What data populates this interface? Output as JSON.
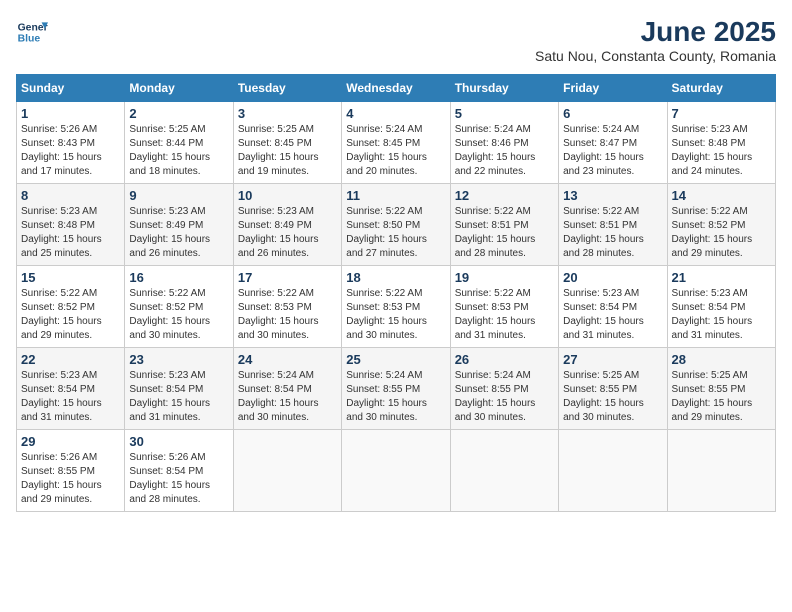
{
  "header": {
    "logo_line1": "General",
    "logo_line2": "Blue",
    "month_title": "June 2025",
    "subtitle": "Satu Nou, Constanta County, Romania"
  },
  "calendar": {
    "days_of_week": [
      "Sunday",
      "Monday",
      "Tuesday",
      "Wednesday",
      "Thursday",
      "Friday",
      "Saturday"
    ],
    "weeks": [
      [
        {
          "day": "",
          "info": ""
        },
        {
          "day": "2",
          "info": "Sunrise: 5:25 AM\nSunset: 8:44 PM\nDaylight: 15 hours\nand 18 minutes."
        },
        {
          "day": "3",
          "info": "Sunrise: 5:25 AM\nSunset: 8:45 PM\nDaylight: 15 hours\nand 19 minutes."
        },
        {
          "day": "4",
          "info": "Sunrise: 5:24 AM\nSunset: 8:45 PM\nDaylight: 15 hours\nand 20 minutes."
        },
        {
          "day": "5",
          "info": "Sunrise: 5:24 AM\nSunset: 8:46 PM\nDaylight: 15 hours\nand 22 minutes."
        },
        {
          "day": "6",
          "info": "Sunrise: 5:24 AM\nSunset: 8:47 PM\nDaylight: 15 hours\nand 23 minutes."
        },
        {
          "day": "7",
          "info": "Sunrise: 5:23 AM\nSunset: 8:48 PM\nDaylight: 15 hours\nand 24 minutes."
        }
      ],
      [
        {
          "day": "1",
          "info": "Sunrise: 5:26 AM\nSunset: 8:43 PM\nDaylight: 15 hours\nand 17 minutes.",
          "first": true
        },
        {
          "day": "9",
          "info": "Sunrise: 5:23 AM\nSunset: 8:49 PM\nDaylight: 15 hours\nand 26 minutes."
        },
        {
          "day": "10",
          "info": "Sunrise: 5:23 AM\nSunset: 8:49 PM\nDaylight: 15 hours\nand 26 minutes."
        },
        {
          "day": "11",
          "info": "Sunrise: 5:22 AM\nSunset: 8:50 PM\nDaylight: 15 hours\nand 27 minutes."
        },
        {
          "day": "12",
          "info": "Sunrise: 5:22 AM\nSunset: 8:51 PM\nDaylight: 15 hours\nand 28 minutes."
        },
        {
          "day": "13",
          "info": "Sunrise: 5:22 AM\nSunset: 8:51 PM\nDaylight: 15 hours\nand 28 minutes."
        },
        {
          "day": "14",
          "info": "Sunrise: 5:22 AM\nSunset: 8:52 PM\nDaylight: 15 hours\nand 29 minutes."
        }
      ],
      [
        {
          "day": "8",
          "info": "Sunrise: 5:23 AM\nSunset: 8:48 PM\nDaylight: 15 hours\nand 25 minutes."
        },
        {
          "day": "16",
          "info": "Sunrise: 5:22 AM\nSunset: 8:52 PM\nDaylight: 15 hours\nand 30 minutes."
        },
        {
          "day": "17",
          "info": "Sunrise: 5:22 AM\nSunset: 8:53 PM\nDaylight: 15 hours\nand 30 minutes."
        },
        {
          "day": "18",
          "info": "Sunrise: 5:22 AM\nSunset: 8:53 PM\nDaylight: 15 hours\nand 30 minutes."
        },
        {
          "day": "19",
          "info": "Sunrise: 5:22 AM\nSunset: 8:53 PM\nDaylight: 15 hours\nand 31 minutes."
        },
        {
          "day": "20",
          "info": "Sunrise: 5:23 AM\nSunset: 8:54 PM\nDaylight: 15 hours\nand 31 minutes."
        },
        {
          "day": "21",
          "info": "Sunrise: 5:23 AM\nSunset: 8:54 PM\nDaylight: 15 hours\nand 31 minutes."
        }
      ],
      [
        {
          "day": "15",
          "info": "Sunrise: 5:22 AM\nSunset: 8:52 PM\nDaylight: 15 hours\nand 29 minutes."
        },
        {
          "day": "23",
          "info": "Sunrise: 5:23 AM\nSunset: 8:54 PM\nDaylight: 15 hours\nand 31 minutes."
        },
        {
          "day": "24",
          "info": "Sunrise: 5:24 AM\nSunset: 8:54 PM\nDaylight: 15 hours\nand 30 minutes."
        },
        {
          "day": "25",
          "info": "Sunrise: 5:24 AM\nSunset: 8:55 PM\nDaylight: 15 hours\nand 30 minutes."
        },
        {
          "day": "26",
          "info": "Sunrise: 5:24 AM\nSunset: 8:55 PM\nDaylight: 15 hours\nand 30 minutes."
        },
        {
          "day": "27",
          "info": "Sunrise: 5:25 AM\nSunset: 8:55 PM\nDaylight: 15 hours\nand 30 minutes."
        },
        {
          "day": "28",
          "info": "Sunrise: 5:25 AM\nSunset: 8:55 PM\nDaylight: 15 hours\nand 29 minutes."
        }
      ],
      [
        {
          "day": "22",
          "info": "Sunrise: 5:23 AM\nSunset: 8:54 PM\nDaylight: 15 hours\nand 31 minutes."
        },
        {
          "day": "30",
          "info": "Sunrise: 5:26 AM\nSunset: 8:54 PM\nDaylight: 15 hours\nand 28 minutes."
        },
        {
          "day": "",
          "info": ""
        },
        {
          "day": "",
          "info": ""
        },
        {
          "day": "",
          "info": ""
        },
        {
          "day": "",
          "info": ""
        },
        {
          "day": "",
          "info": ""
        }
      ],
      [
        {
          "day": "29",
          "info": "Sunrise: 5:26 AM\nSunset: 8:55 PM\nDaylight: 15 hours\nand 29 minutes."
        },
        {
          "day": "",
          "info": ""
        },
        {
          "day": "",
          "info": ""
        },
        {
          "day": "",
          "info": ""
        },
        {
          "day": "",
          "info": ""
        },
        {
          "day": "",
          "info": ""
        },
        {
          "day": "",
          "info": ""
        }
      ]
    ]
  }
}
